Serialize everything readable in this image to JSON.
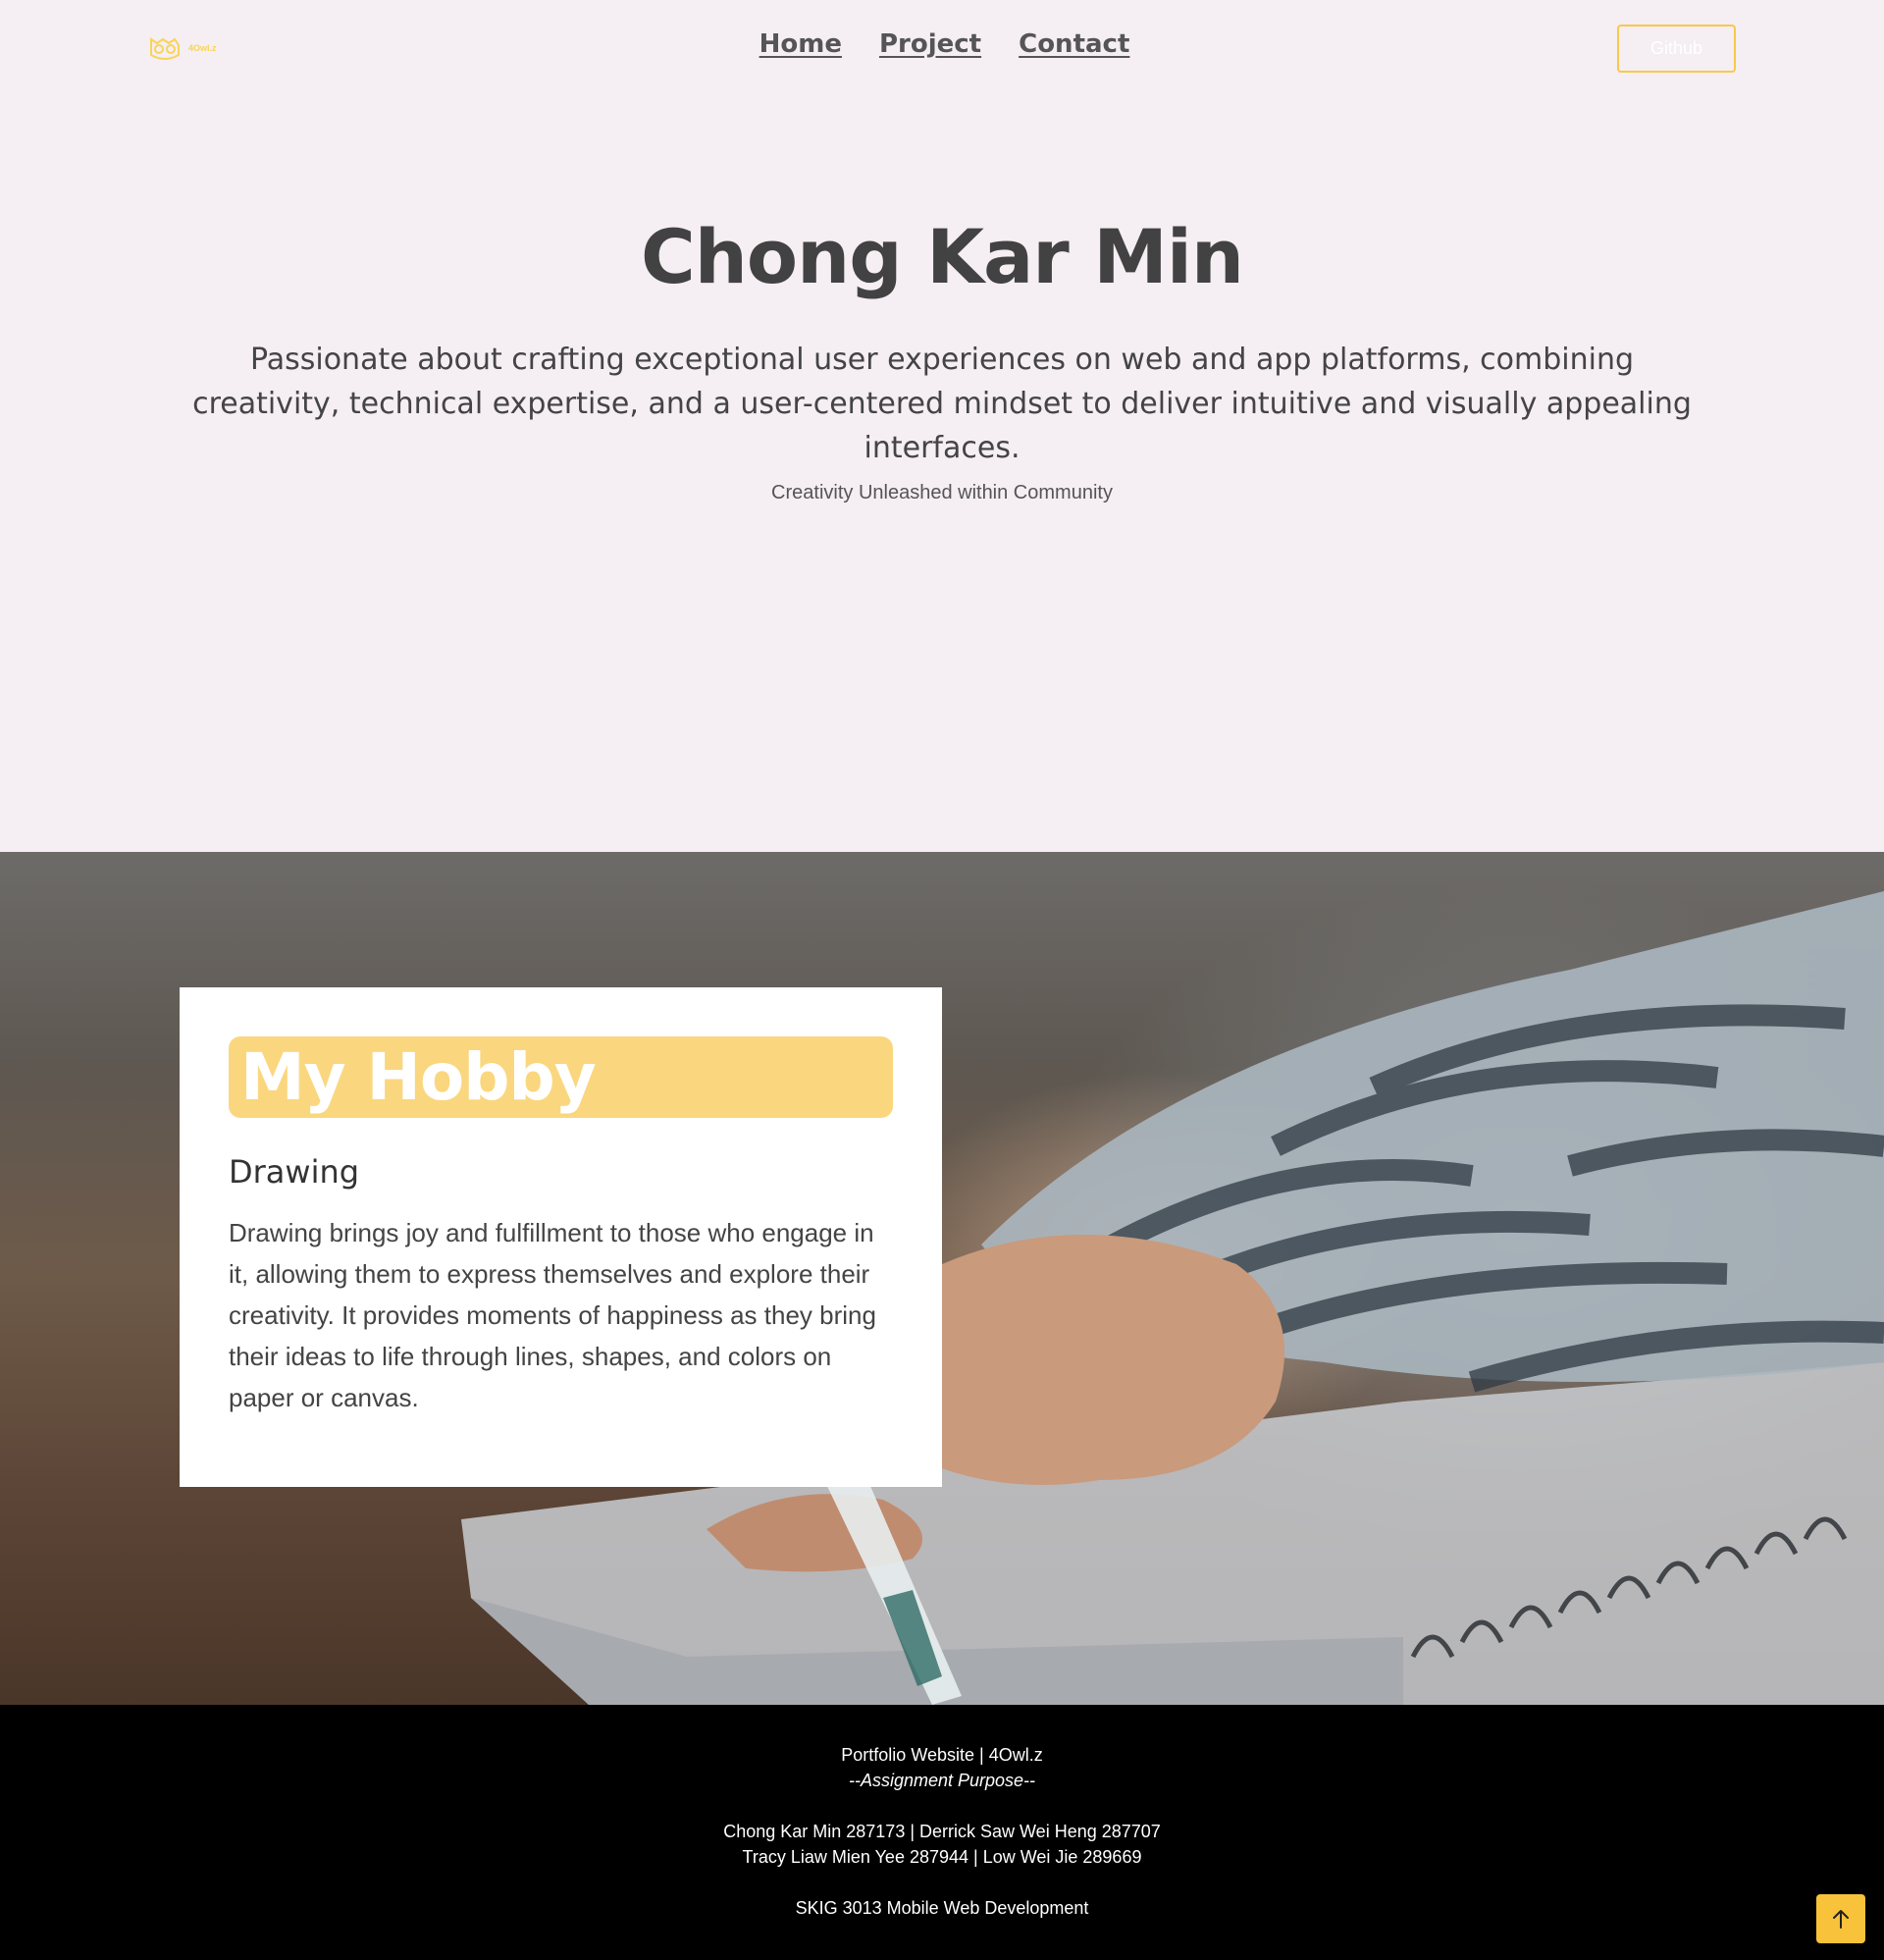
{
  "colors": {
    "accent": "#f8c94a",
    "hero_bg": "#f5eef2",
    "hobby_heading_bg": "#fad77e",
    "footer_bg": "#000000"
  },
  "header": {
    "logo_text": "4Owl.z",
    "logo_icon": "owl-icon",
    "nav": [
      "Home",
      "Project",
      "Contact"
    ],
    "github_label": "Github"
  },
  "hero": {
    "title": "Chong Kar Min",
    "description": "Passionate about crafting exceptional user experiences on web and app platforms, combining creativity, technical expertise, and a user-centered mindset to deliver intuitive and visually appealing interfaces.",
    "tagline": "Creativity Unleashed within Community"
  },
  "hobby": {
    "heading": "My Hobby",
    "subheading": "Drawing",
    "text": "Drawing brings joy and fulfillment to those who engage in it, allowing them to express themselves and explore their creativity. It provides moments of happiness as they bring their ideas to life through lines, shapes, and colors on paper or canvas."
  },
  "footer": {
    "line1": "Portfolio Website | 4Owl.z",
    "line2": "--Assignment Purpose--",
    "line3": "Chong Kar Min 287173 | Derrick Saw Wei Heng 287707",
    "line4": "Tracy Liaw Mien Yee 287944 | Low Wei Jie 289669",
    "line5": "SKIG 3013 Mobile Web Development",
    "back_to_top_icon": "arrow-up-icon"
  }
}
